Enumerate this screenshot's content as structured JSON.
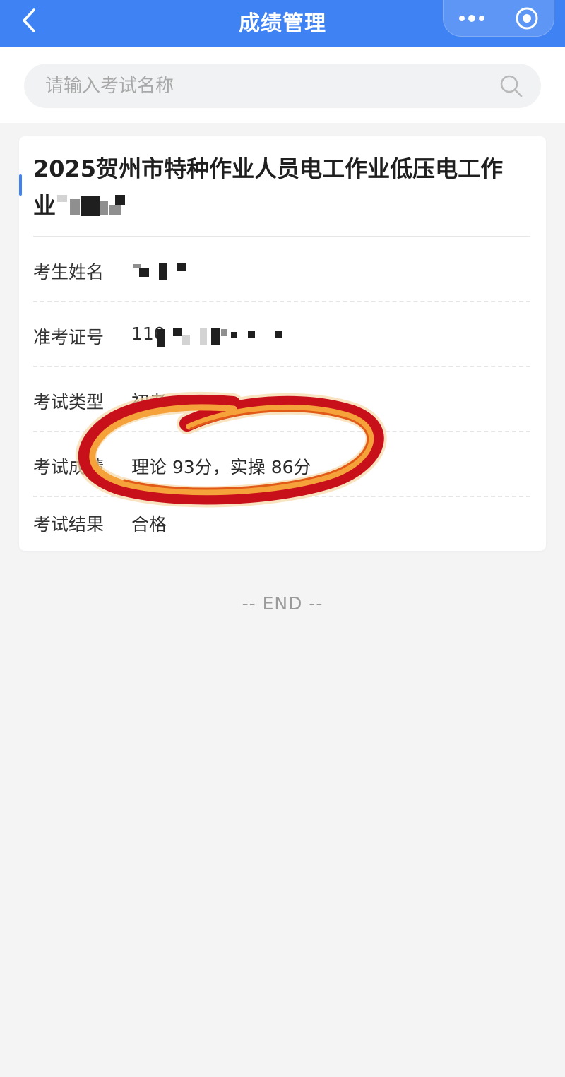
{
  "header": {
    "title": "成绩管理",
    "back_icon": "chevron-left-icon",
    "more_icon": "more-dots-icon",
    "close_icon": "target-circle-icon",
    "bar_color": "#3f82f3"
  },
  "search": {
    "placeholder": "请输入考试名称",
    "value": "",
    "icon": "search-icon"
  },
  "card": {
    "title_line1": "2025贺州市特种作业人员电工作业低压电工作",
    "title_line2_visible": "业",
    "title_line2_redacted": true,
    "rows": [
      {
        "label": "考生姓名",
        "value": "",
        "redacted": true
      },
      {
        "label": "准考证号",
        "value": "110",
        "redacted": true
      },
      {
        "label": "考试类型",
        "value": "初考"
      },
      {
        "label": "考试成绩",
        "value": "理论 93分，实操 86分"
      },
      {
        "label": "考试结果",
        "value": "合格"
      }
    ]
  },
  "footer": {
    "end_text": "-- END --"
  },
  "annotation": {
    "type": "hand-drawn ribbon circle",
    "colors": [
      "#c8101a",
      "#f6a23a",
      "#e25a18"
    ]
  }
}
